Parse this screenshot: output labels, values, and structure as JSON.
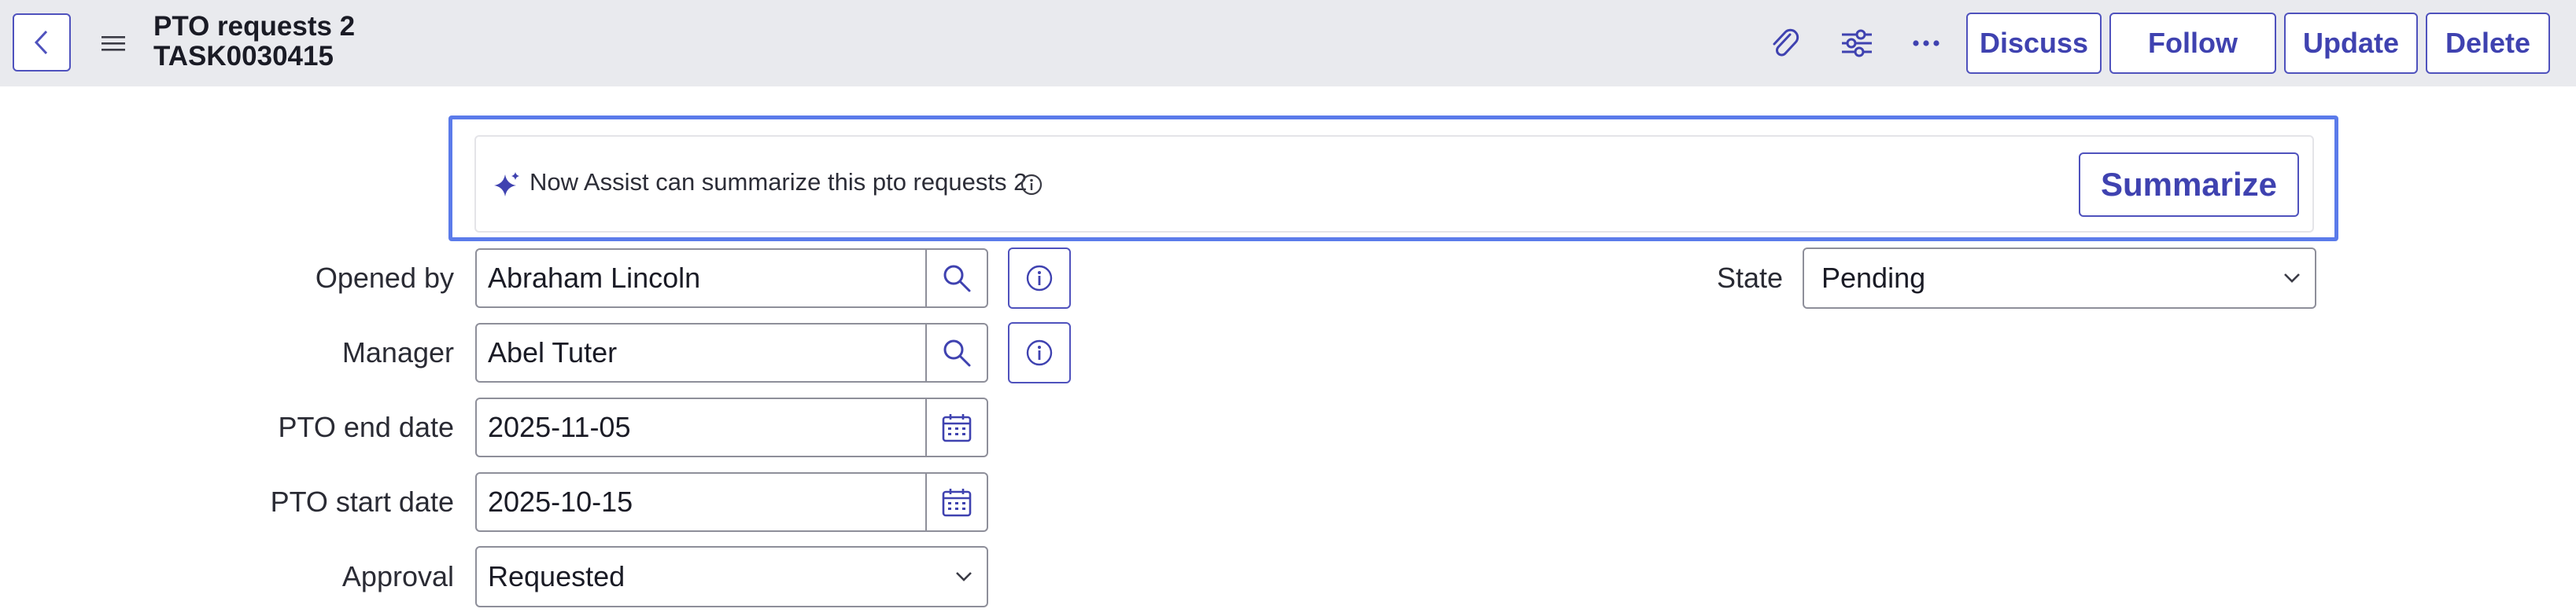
{
  "header": {
    "title": "PTO requests 2",
    "number": "TASK0030415",
    "icons": [
      "back-icon",
      "hamburger-icon",
      "paperclip-icon",
      "sliders-icon",
      "more-icon"
    ],
    "buttons": {
      "discuss": "Discuss",
      "follow": "Follow",
      "update": "Update",
      "delete": "Delete"
    }
  },
  "assist": {
    "icon": "sparkle-icon",
    "text": "Now Assist can summarize this pto requests 2",
    "info_icon": "info-icon",
    "button": "Summarize"
  },
  "form": {
    "opened_by": {
      "label": "Opened by",
      "value": "Abraham Lincoln"
    },
    "manager": {
      "label": "Manager",
      "value": "Abel Tuter"
    },
    "pto_end_date": {
      "label": "PTO end date",
      "value": "2025-11-05"
    },
    "pto_start_date": {
      "label": "PTO start date",
      "value": "2025-10-15"
    },
    "approval": {
      "label": "Approval",
      "value": "Requested"
    },
    "state": {
      "label": "State",
      "value": "Pending"
    }
  },
  "colors": {
    "accent": "#4f52bd",
    "assist_border": "#5b7bea",
    "header_bg": "#e9eaee"
  }
}
